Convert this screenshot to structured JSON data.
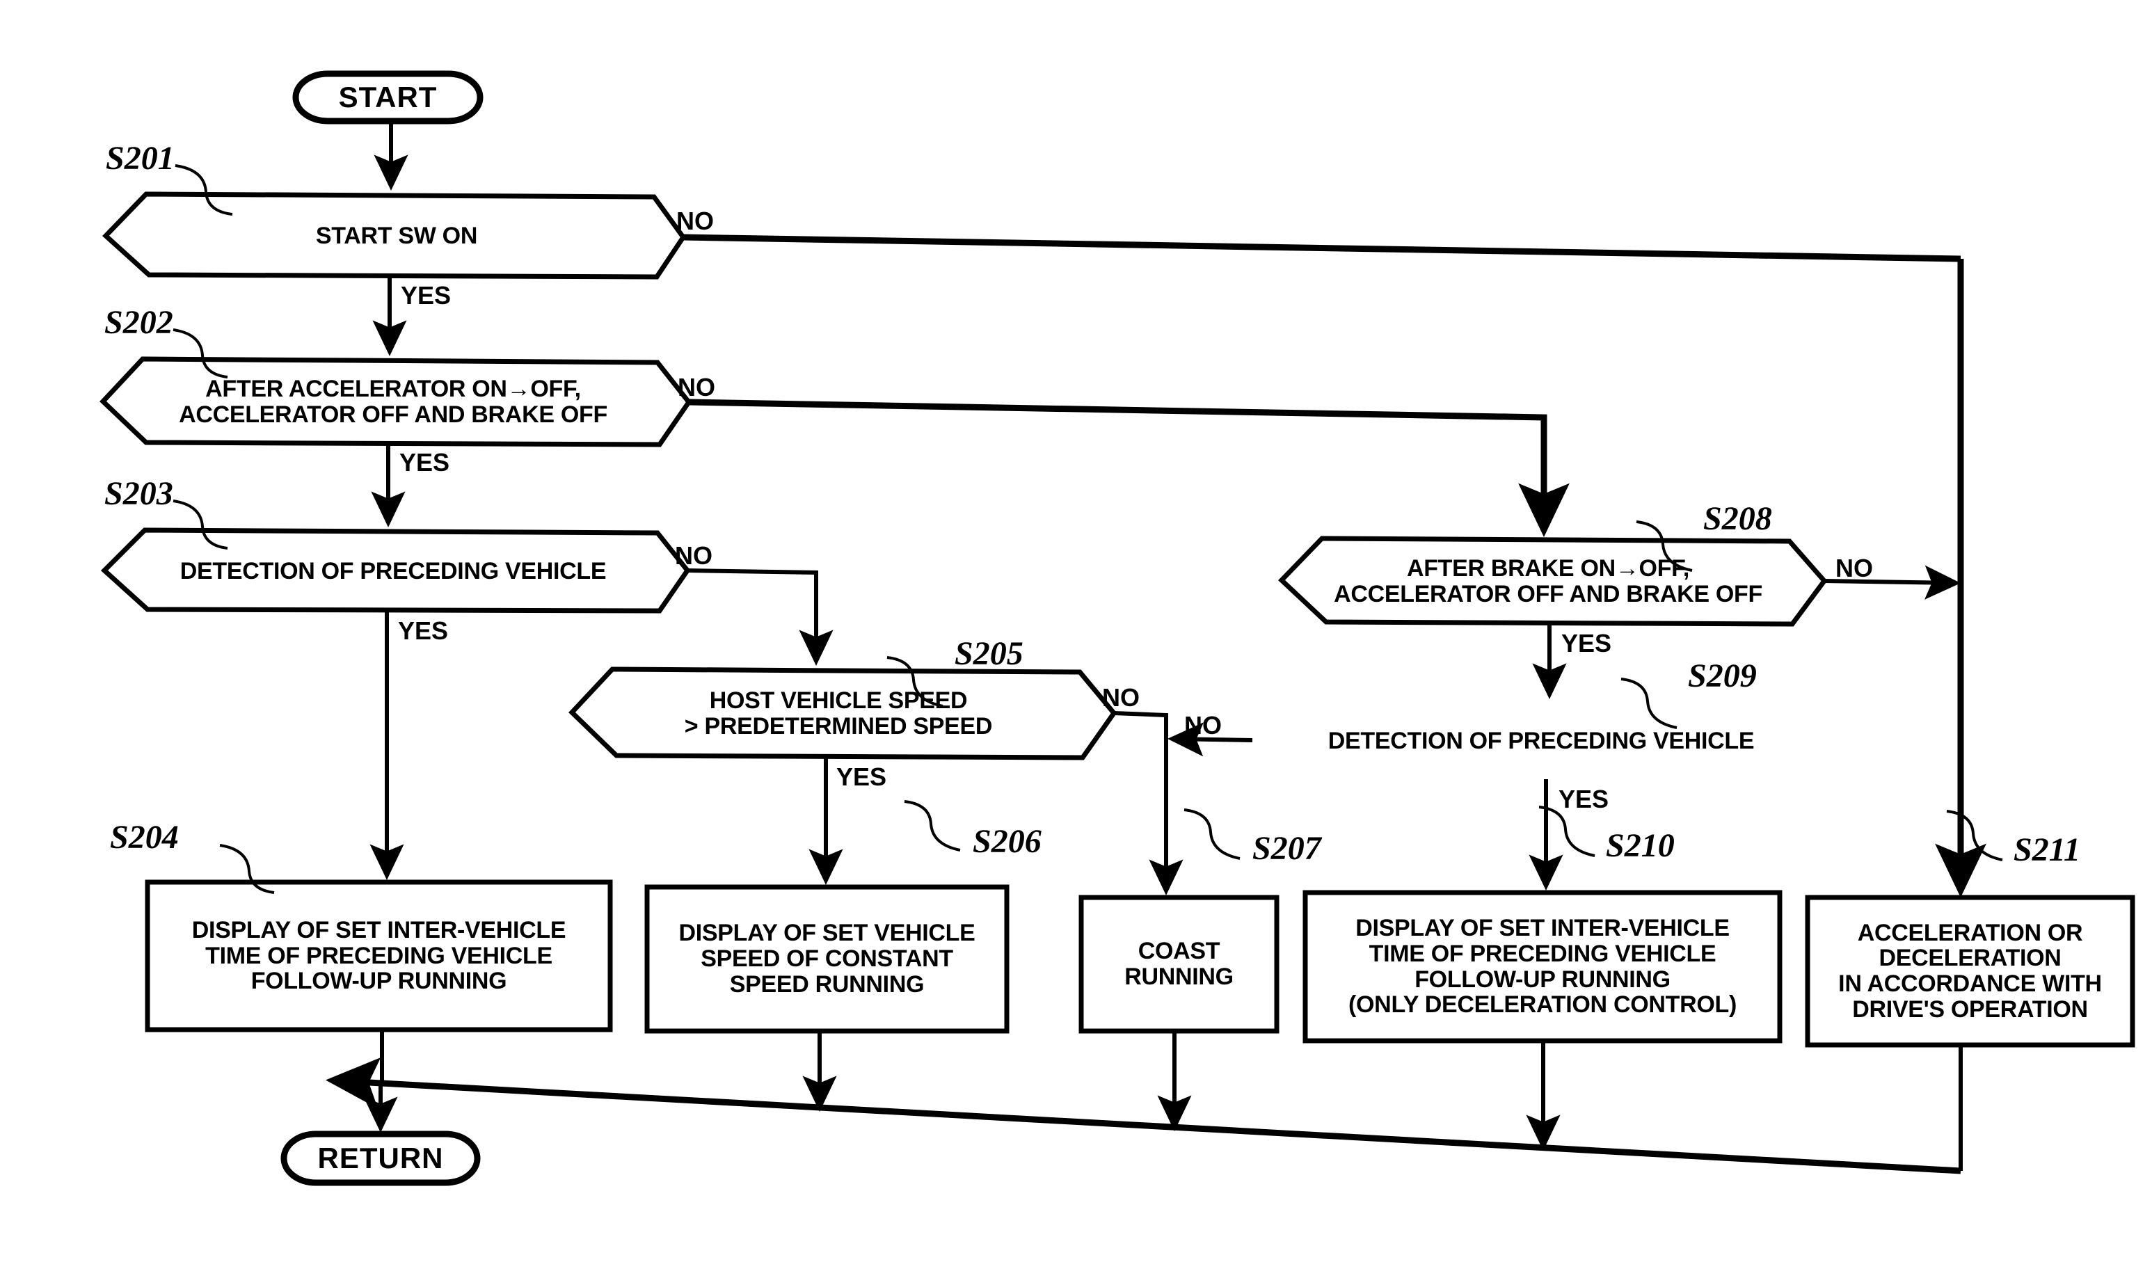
{
  "diagram": {
    "title": "Vehicle Cruise Control Process Flowchart",
    "terminals": {
      "start": "START",
      "return": "RETURN"
    },
    "branch_labels": {
      "yes": "YES",
      "no": "NO"
    },
    "nodes": [
      {
        "id": "S201",
        "ref": "S201",
        "type": "decision",
        "text": "START SW ON"
      },
      {
        "id": "S202",
        "ref": "S202",
        "type": "decision",
        "text": "AFTER ACCELERATOR ON→OFF,\nACCELERATOR OFF AND BRAKE OFF"
      },
      {
        "id": "S203",
        "ref": "S203",
        "type": "decision",
        "text": "DETECTION OF PRECEDING VEHICLE"
      },
      {
        "id": "S204",
        "ref": "S204",
        "type": "process",
        "text": "DISPLAY OF SET INTER-VEHICLE\nTIME OF PRECEDING VEHICLE\nFOLLOW-UP RUNNING"
      },
      {
        "id": "S205",
        "ref": "S205",
        "type": "decision",
        "text": "HOST VEHICLE SPEED\n> PREDETERMINED SPEED"
      },
      {
        "id": "S206",
        "ref": "S206",
        "type": "process",
        "text": "DISPLAY OF SET VEHICLE\nSPEED OF CONSTANT\nSPEED RUNNING"
      },
      {
        "id": "S207",
        "ref": "S207",
        "type": "process",
        "text": "COAST\nRUNNING"
      },
      {
        "id": "S208",
        "ref": "S208",
        "type": "decision",
        "text": "AFTER BRAKE ON→OFF,\nACCELERATOR OFF AND BRAKE OFF"
      },
      {
        "id": "S209",
        "ref": "S209",
        "type": "decision",
        "text": "DETECTION OF PRECEDING VEHICLE"
      },
      {
        "id": "S210",
        "ref": "S210",
        "type": "process",
        "text": "DISPLAY OF SET INTER-VEHICLE\nTIME OF PRECEDING VEHICLE\nFOLLOW-UP RUNNING\n(ONLY DECELERATION CONTROL)"
      },
      {
        "id": "S211",
        "ref": "S211",
        "type": "process",
        "text": "ACCELERATION OR\nDECELERATION\nIN ACCORDANCE WITH\nDRIVE'S OPERATION"
      }
    ],
    "edges": [
      {
        "from": "START",
        "to": "S201",
        "label": ""
      },
      {
        "from": "S201",
        "to": "S202",
        "label": "YES"
      },
      {
        "from": "S201",
        "to": "S211",
        "label": "NO"
      },
      {
        "from": "S202",
        "to": "S203",
        "label": "YES"
      },
      {
        "from": "S202",
        "to": "S208",
        "label": "NO"
      },
      {
        "from": "S203",
        "to": "S204",
        "label": "YES"
      },
      {
        "from": "S203",
        "to": "S205",
        "label": "NO"
      },
      {
        "from": "S205",
        "to": "S206",
        "label": "YES"
      },
      {
        "from": "S205",
        "to": "S207",
        "label": "NO"
      },
      {
        "from": "S208",
        "to": "S209",
        "label": "YES"
      },
      {
        "from": "S208",
        "to": "S211",
        "label": "NO"
      },
      {
        "from": "S209",
        "to": "S210",
        "label": "YES"
      },
      {
        "from": "S209",
        "to": "S207",
        "label": "NO"
      },
      {
        "from": "S204",
        "to": "RETURN",
        "label": ""
      },
      {
        "from": "S206",
        "to": "RETURN",
        "label": ""
      },
      {
        "from": "S207",
        "to": "RETURN",
        "label": ""
      },
      {
        "from": "S210",
        "to": "RETURN",
        "label": ""
      },
      {
        "from": "S211",
        "to": "RETURN",
        "label": ""
      }
    ],
    "colors": {
      "stroke": "#000000",
      "fill": "#ffffff",
      "text": "#000000"
    }
  }
}
